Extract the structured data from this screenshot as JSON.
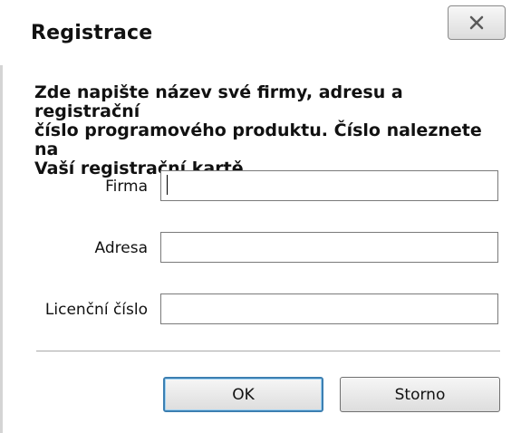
{
  "window": {
    "title": "Registrace",
    "close_icon": "close-icon"
  },
  "instructions": {
    "line1": "Zde napište název své firmy, adresu a registrační",
    "line2": "číslo programového produktu. Číslo naleznete na",
    "line3": "Vaší registrační kartě."
  },
  "form": {
    "firma_label": "Firma",
    "firma_value": "",
    "adresa_label": "Adresa",
    "adresa_value": "",
    "licence_label": "Licenční číslo",
    "licence_value": ""
  },
  "buttons": {
    "ok_label": "OK",
    "cancel_label": "Storno"
  }
}
